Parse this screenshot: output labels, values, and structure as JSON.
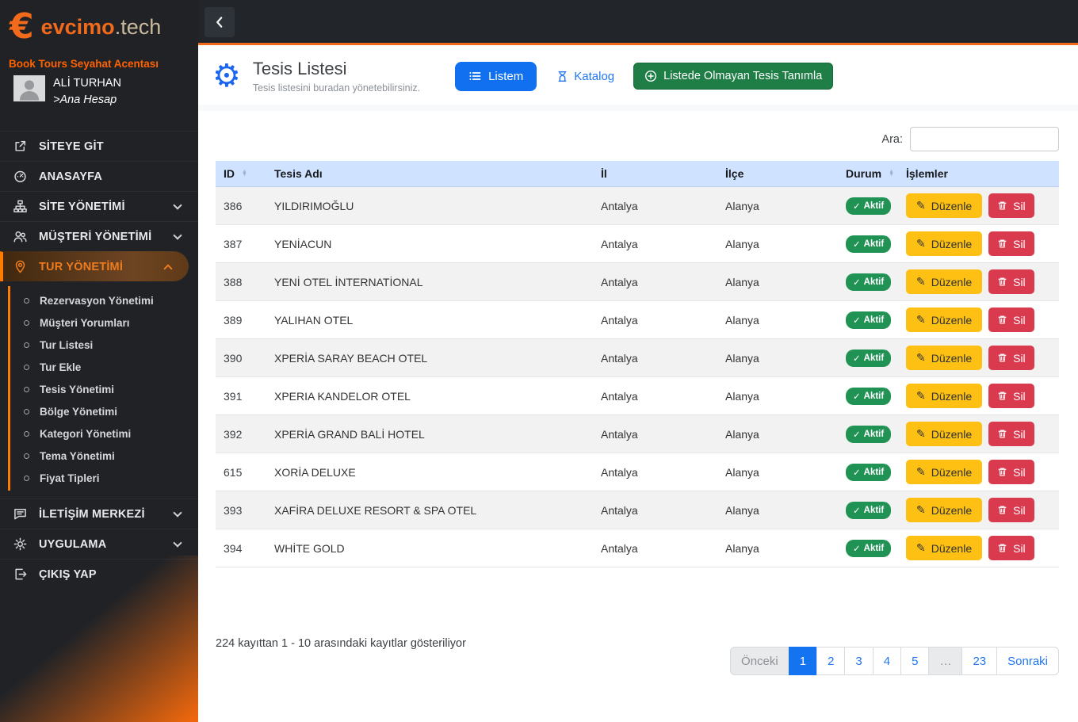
{
  "colors": {
    "accent_orange": "#f26a1b",
    "brand_orange": "#ff6200",
    "primary_blue": "#1070ef",
    "link_blue": "#2276f2",
    "success_green": "#1f9254",
    "warning_yellow": "#fdc013",
    "danger_red": "#da3a4e",
    "table_header_bg": "#cfe2ff",
    "sidebar_bg": "#202226",
    "active_item_text": "#ee7c1e"
  },
  "brand": {
    "logo_mark": "€",
    "logo_primary": "evcimo",
    "logo_secondary": ".tech",
    "agency": "Book Tours Seyahat Acentası",
    "user_name": "ALİ TURHAN",
    "user_role": ">Ana Hesap"
  },
  "sidebar": {
    "items": [
      {
        "key": "siteye-git",
        "label": "SİTEYE GİT",
        "icon": "external-link-icon"
      },
      {
        "key": "anasayfa",
        "label": "ANASAYFA",
        "icon": "dashboard-icon"
      },
      {
        "key": "site-yonetimi",
        "label": "SİTE YÖNETİMİ",
        "icon": "sitemap-icon",
        "chevron": "down"
      },
      {
        "key": "musteri-yonetimi",
        "label": "MÜŞTERİ YÖNETİMİ",
        "icon": "users-icon",
        "chevron": "down"
      },
      {
        "key": "tur-yonetimi",
        "label": "TUR YÖNETİMİ",
        "icon": "map-pin-icon",
        "chevron": "up",
        "active": true,
        "submenu": [
          "Rezervasyon Yönetimi",
          "Müşteri Yorumları",
          "Tur Listesi",
          "Tur Ekle",
          "Tesis Yönetimi",
          "Bölge Yönetimi",
          "Kategori Yönetimi",
          "Tema Yönetimi",
          "Fiyat Tipleri"
        ]
      },
      {
        "key": "iletisim-merkezi",
        "label": "İLETİŞİM MERKEZİ",
        "icon": "chat-icon",
        "chevron": "down"
      },
      {
        "key": "uygulama",
        "label": "UYGULAMA",
        "icon": "gear-icon",
        "chevron": "down"
      },
      {
        "key": "cikis-yap",
        "label": "ÇIKIŞ YAP",
        "icon": "logout-icon"
      }
    ]
  },
  "header": {
    "title": "Tesis Listesi",
    "subtitle": "Tesis listesini buradan yönetebilirsiniz.",
    "listem_label": "Listem",
    "katalog_label": "Katalog",
    "define_label": "Listede Olmayan Tesis Tanımla"
  },
  "search": {
    "label": "Ara:",
    "value": ""
  },
  "table": {
    "headers": [
      {
        "label": "ID",
        "sortable": true
      },
      {
        "label": "Tesis Adı",
        "sortable": false
      },
      {
        "label": "İl",
        "sortable": false
      },
      {
        "label": "İlçe",
        "sortable": false
      },
      {
        "label": "Durum",
        "sortable": true
      },
      {
        "label": "İşlemler",
        "sortable": false
      }
    ],
    "rows": [
      {
        "id": "386",
        "name": "YILDIRIMOĞLU",
        "il": "Antalya",
        "ilce": "Alanya",
        "status": "Aktif"
      },
      {
        "id": "387",
        "name": "YENİACUN",
        "il": "Antalya",
        "ilce": "Alanya",
        "status": "Aktif"
      },
      {
        "id": "388",
        "name": "YENİ OTEL İNTERNATİONAL",
        "il": "Antalya",
        "ilce": "Alanya",
        "status": "Aktif"
      },
      {
        "id": "389",
        "name": "YALIHAN OTEL",
        "il": "Antalya",
        "ilce": "Alanya",
        "status": "Aktif"
      },
      {
        "id": "390",
        "name": "XPERİA SARAY BEACH OTEL",
        "il": "Antalya",
        "ilce": "Alanya",
        "status": "Aktif"
      },
      {
        "id": "391",
        "name": "XPERIA KANDELOR OTEL",
        "il": "Antalya",
        "ilce": "Alanya",
        "status": "Aktif"
      },
      {
        "id": "392",
        "name": "XPERİA GRAND BALİ HOTEL",
        "il": "Antalya",
        "ilce": "Alanya",
        "status": "Aktif"
      },
      {
        "id": "615",
        "name": "XORİA DELUXE",
        "il": "Antalya",
        "ilce": "Alanya",
        "status": "Aktif"
      },
      {
        "id": "393",
        "name": "XAFİRA DELUXE RESORT & SPA OTEL",
        "il": "Antalya",
        "ilce": "Alanya",
        "status": "Aktif"
      },
      {
        "id": "394",
        "name": "WHİTE GOLD",
        "il": "Antalya",
        "ilce": "Alanya",
        "status": "Aktif"
      }
    ],
    "edit_label": "Düzenle",
    "delete_label": "Sil"
  },
  "footer": {
    "info": "224 kayıttan 1 - 10 arasındaki kayıtlar gösteriliyor"
  },
  "pagination": {
    "prev": "Önceki",
    "next": "Sonraki",
    "pages": [
      "1",
      "2",
      "3",
      "4",
      "5",
      "…",
      "23"
    ],
    "active_page": "1",
    "disabled_pages": [
      "…"
    ]
  },
  "glyphs": {
    "check": "✓",
    "pencil": "✎",
    "sort_asc": "▲",
    "sort_desc": "▼",
    "gear_large": "⚙"
  }
}
